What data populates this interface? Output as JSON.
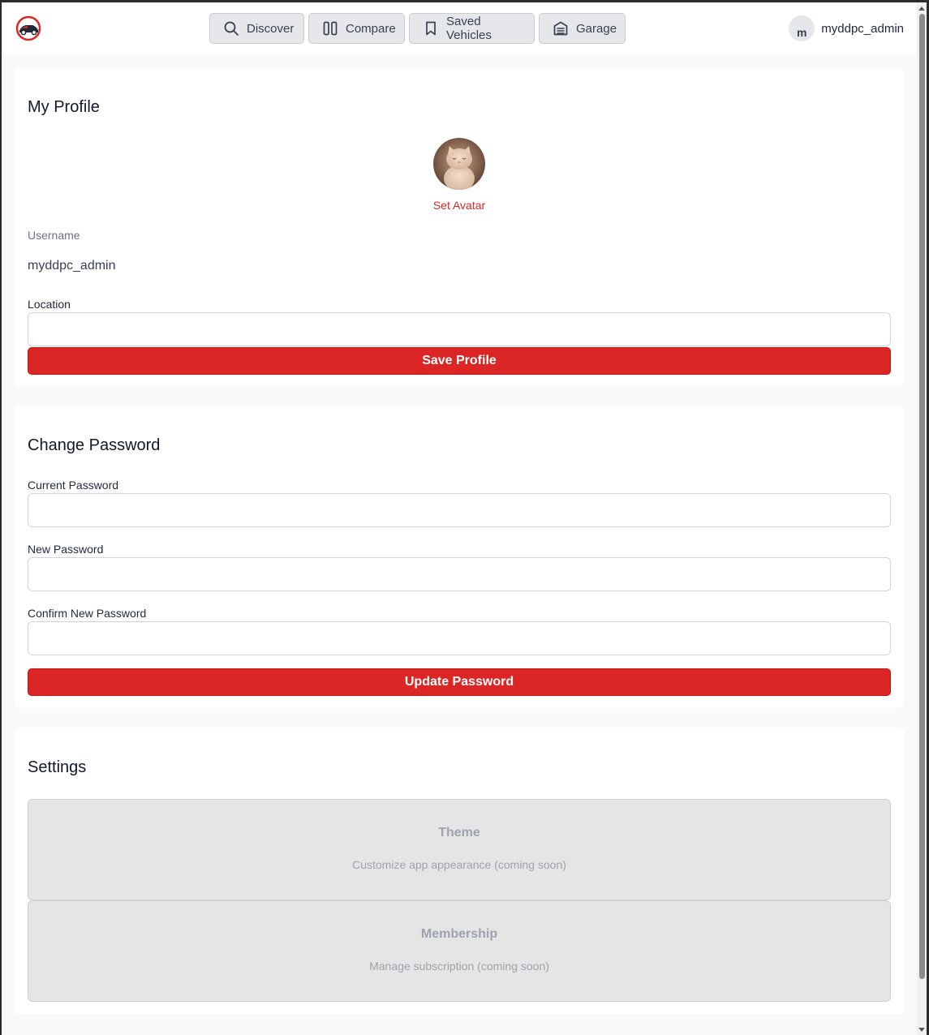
{
  "header": {
    "nav": [
      {
        "label": "Discover",
        "icon": "search-icon"
      },
      {
        "label": "Compare",
        "icon": "compare-columns-icon"
      },
      {
        "label": "Saved Vehicles",
        "icon": "bookmark-icon"
      },
      {
        "label": "Garage",
        "icon": "garage-icon"
      }
    ],
    "user": {
      "initial": "m",
      "name": "myddpc_admin"
    }
  },
  "profile": {
    "title": "My Profile",
    "set_avatar": "Set Avatar",
    "username_label": "Username",
    "username_value": "myddpc_admin",
    "location_label": "Location",
    "location_value": "",
    "save_label": "Save Profile"
  },
  "password": {
    "title": "Change Password",
    "current_label": "Current Password",
    "new_label": "New Password",
    "confirm_label": "Confirm New Password",
    "update_label": "Update Password"
  },
  "settings": {
    "title": "Settings",
    "tiles": [
      {
        "title": "Theme",
        "description": "Customize app appearance (coming soon)"
      },
      {
        "title": "Membership",
        "description": "Manage subscription (coming soon)"
      }
    ]
  },
  "colors": {
    "accent": "#dc2626",
    "muted_tile": "#e5e5e5"
  }
}
